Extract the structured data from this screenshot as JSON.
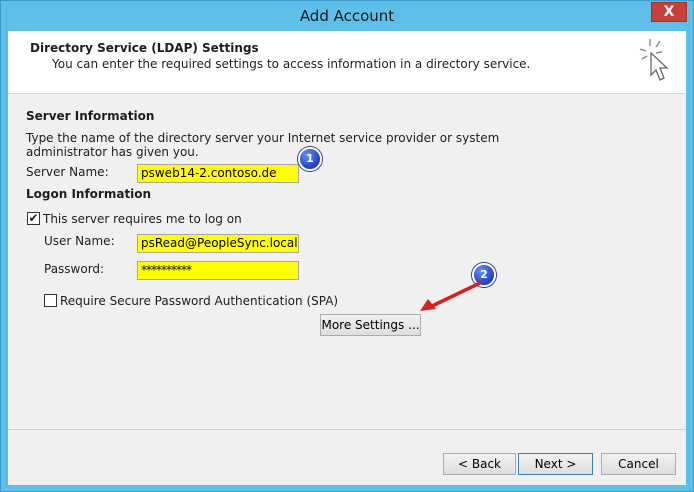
{
  "window": {
    "title": "Add Account",
    "close_label": "X"
  },
  "header": {
    "title": "Directory Service (LDAP) Settings",
    "subtitle": "You can enter the required settings to access information in a directory service."
  },
  "server_info": {
    "heading": "Server Information",
    "description_line1": "Type the name of the directory server your Internet service provider or system",
    "description_line2": "administrator has given you.",
    "server_name_label": "Server Name:",
    "server_name_value": "psweb14-2.contoso.de"
  },
  "logon_info": {
    "heading": "Logon Information",
    "requires_logon_label": "This server requires me to log on",
    "requires_logon_checked": true,
    "user_name_label": "User Name:",
    "user_name_value": "psRead@PeopleSync.local",
    "password_label": "Password:",
    "password_value": "**********",
    "spa_label": "Require Secure Password Authentication (SPA)",
    "spa_checked": false
  },
  "buttons": {
    "more_settings": "More Settings ...",
    "back": "< Back",
    "next": "Next >",
    "cancel": "Cancel"
  },
  "annotations": {
    "badge1": "1",
    "badge2": "2",
    "badge_color": "#2447d1",
    "arrow_color": "#d42020"
  },
  "colors": {
    "title_bar": "#5ec0e8",
    "highlight": "#ffff00"
  }
}
